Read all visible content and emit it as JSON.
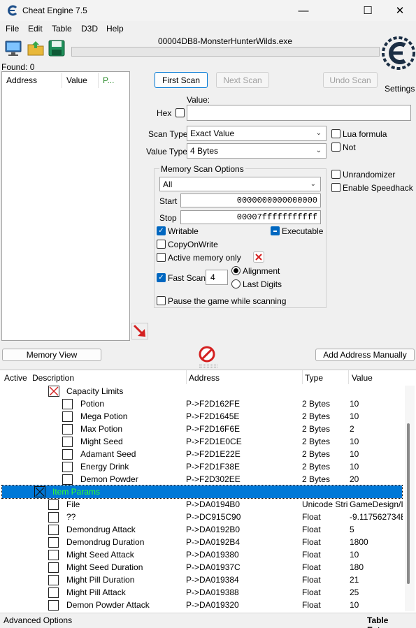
{
  "window": {
    "title": "Cheat Engine 7.5",
    "minimize": "—",
    "maximize": "☐",
    "close": "✕"
  },
  "menu": [
    "File",
    "Edit",
    "Table",
    "D3D",
    "Help"
  ],
  "toolbar": {
    "process": "00004DB8-MonsterHunterWilds.exe",
    "settings_label": "Settings"
  },
  "found": {
    "label": "Found: 0",
    "columns": [
      "Address",
      "Value",
      "P..."
    ]
  },
  "scan": {
    "first_scan": "First Scan",
    "next_scan": "Next Scan",
    "undo_scan": "Undo Scan",
    "value_label": "Value:",
    "hex_label": "Hex",
    "value": "",
    "scan_type_label": "Scan Type",
    "scan_type": "Exact Value",
    "value_type_label": "Value Type",
    "value_type": "4 Bytes",
    "lua_formula": "Lua formula",
    "not": "Not",
    "unrandomizer": "Unrandomizer",
    "enable_speedhack": "Enable Speedhack"
  },
  "memory_options": {
    "title": "Memory Scan Options",
    "region": "All",
    "start_label": "Start",
    "start": "0000000000000000",
    "stop_label": "Stop",
    "stop": "00007fffffffffff",
    "writable": "Writable",
    "executable": "Executable",
    "copy_on_write": "CopyOnWrite",
    "active_memory_only": "Active memory only",
    "fast_scan": "Fast Scan",
    "fast_scan_value": "4",
    "alignment": "Alignment",
    "last_digits": "Last Digits",
    "pause_game": "Pause the game while scanning"
  },
  "buttons": {
    "memory_view": "Memory View",
    "add_address": "Add Address Manually"
  },
  "table": {
    "columns": [
      "Active",
      "Description",
      "Address",
      "Type",
      "Value"
    ],
    "rows": [
      {
        "desc": "Capacity Limits",
        "addr": "",
        "type": "",
        "value": ""
      },
      {
        "desc": "Potion",
        "addr": "P->F2D162FE",
        "type": "2 Bytes",
        "value": "10"
      },
      {
        "desc": "Mega Potion",
        "addr": "P->F2D1645E",
        "type": "2 Bytes",
        "value": "10"
      },
      {
        "desc": "Max Potion",
        "addr": "P->F2D16F6E",
        "type": "2 Bytes",
        "value": "2"
      },
      {
        "desc": "Might Seed",
        "addr": "P->F2D1E0CE",
        "type": "2 Bytes",
        "value": "10"
      },
      {
        "desc": "Adamant Seed",
        "addr": "P->F2D1E22E",
        "type": "2 Bytes",
        "value": "10"
      },
      {
        "desc": "Energy Drink",
        "addr": "P->F2D1F38E",
        "type": "2 Bytes",
        "value": "10"
      },
      {
        "desc": "Demon Powder",
        "addr": "P->F2D302EE",
        "type": "2 Bytes",
        "value": "20"
      },
      {
        "desc": "Item Params",
        "addr": "",
        "type": "",
        "value": ""
      },
      {
        "desc": "File",
        "addr": "P->DA0194B0",
        "type": "Unicode Strir",
        "value": "GameDesign/I"
      },
      {
        "desc": "??",
        "addr": "P->DC915C90",
        "type": "Float",
        "value": "-9.117562734E"
      },
      {
        "desc": "Demondrug Attack",
        "addr": "P->DA0192B0",
        "type": "Float",
        "value": "5"
      },
      {
        "desc": "Demondrug Duration",
        "addr": "P->DA0192B4",
        "type": "Float",
        "value": "1800"
      },
      {
        "desc": "Might Seed Attack",
        "addr": "P->DA019380",
        "type": "Float",
        "value": "10"
      },
      {
        "desc": "Might Seed Duration",
        "addr": "P->DA01937C",
        "type": "Float",
        "value": "180"
      },
      {
        "desc": "Might Pill Duration",
        "addr": "P->DA019384",
        "type": "Float",
        "value": "21"
      },
      {
        "desc": "Might Pill Attack",
        "addr": "P->DA019388",
        "type": "Float",
        "value": "25"
      },
      {
        "desc": "Demon Powder Attack",
        "addr": "P->DA019320",
        "type": "Float",
        "value": "10"
      }
    ]
  },
  "status": {
    "left": "Advanced Options",
    "right": "Table Extras"
  },
  "colors": {
    "selection": "#0078d7",
    "selection_text": "#30ff30",
    "accent": "#0067c0"
  }
}
